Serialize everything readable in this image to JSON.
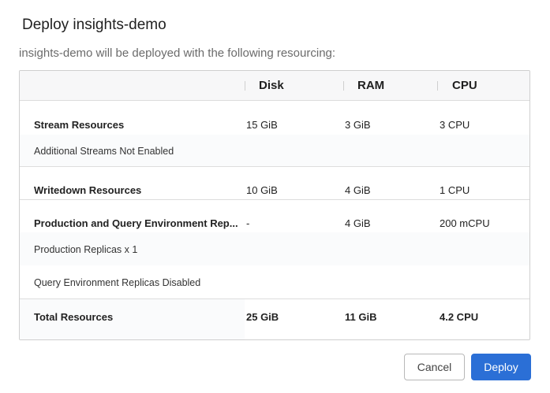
{
  "dialog": {
    "title": "Deploy insights-demo",
    "subtitle": "insights-demo will be deployed with the following resourcing:"
  },
  "table": {
    "columns": [
      "",
      "Disk",
      "RAM",
      "CPU"
    ],
    "rows": [
      {
        "label": "Stream Resources",
        "disk": "15 GiB",
        "ram": "3 GiB",
        "cpu": "3 CPU"
      },
      {
        "label": "Additional Streams Not Enabled"
      },
      {
        "label": "Writedown Resources",
        "disk": "10 GiB",
        "ram": "4 GiB",
        "cpu": "1 CPU"
      },
      {
        "label": "Production and Query Environment Rep...",
        "disk": "-",
        "ram": "4 GiB",
        "cpu": "200 mCPU"
      },
      {
        "label": "Production Replicas x 1"
      },
      {
        "label": "Query Environment Replicas Disabled"
      }
    ],
    "total": {
      "label": "Total Resources",
      "disk": "25 GiB",
      "ram": "11 GiB",
      "cpu": "4.2 CPU"
    }
  },
  "buttons": {
    "cancel_label": "Cancel",
    "deploy_label": "Deploy"
  },
  "colors": {
    "primary": "#2b6fd6",
    "header_bg": "#f7f7f8",
    "border": "#cfcfcf"
  }
}
